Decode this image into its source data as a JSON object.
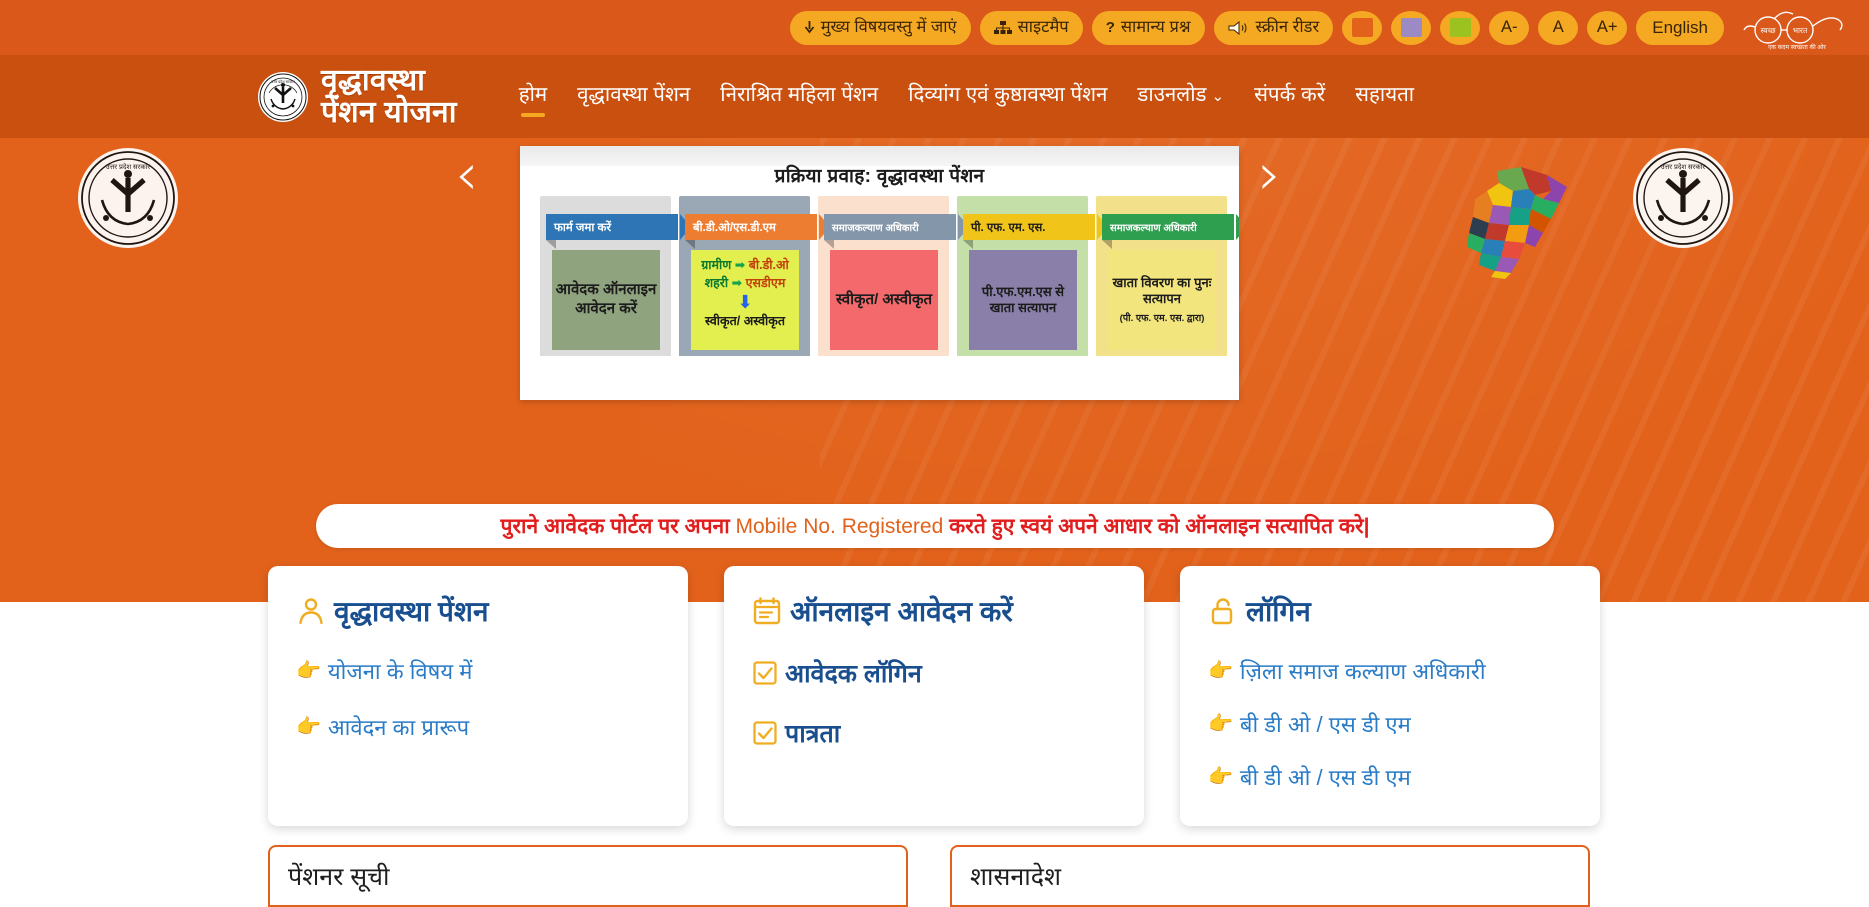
{
  "topbar": {
    "skip_to_main": "मुख्य विषयवस्तु में जाएं",
    "sitemap": "साइटमैप",
    "faq": "सामान्य प्रश्न",
    "screen_reader": "स्क्रीन रीडर",
    "theme_orange": "",
    "theme_purple": "",
    "theme_green": "",
    "font_decrease": "A-",
    "font_normal": "A",
    "font_increase": "A+",
    "language": "English",
    "swachh_bharat_left": "स्वच्छ",
    "swachh_bharat_right": "भारत",
    "swachh_bharat_tagline": "एक कदम स्वच्छता की ओर",
    "colors": {
      "bar": "#d9581a",
      "pill": "#f5a922",
      "orange": "#e2621b",
      "purple": "#9b8ac4",
      "green": "#9cc21f"
    }
  },
  "brand": {
    "line1": "वृद्धावस्था",
    "line2": "पेंशन योजना",
    "emblem_text": "उत्तर प्रदेश सरकार"
  },
  "nav": {
    "items": [
      {
        "label": "होम",
        "active": true,
        "dropdown": false
      },
      {
        "label": "वृद्धावस्था पेंशन",
        "active": false,
        "dropdown": false
      },
      {
        "label": "निराश्रित महिला पेंशन",
        "active": false,
        "dropdown": false
      },
      {
        "label": "दिव्यांग एवं कुष्ठावस्था पेंशन",
        "active": false,
        "dropdown": false
      },
      {
        "label": "डाउनलोड",
        "active": false,
        "dropdown": true
      },
      {
        "label": "संपर्क करें",
        "active": false,
        "dropdown": false
      },
      {
        "label": "सहायता",
        "active": false,
        "dropdown": false
      }
    ],
    "caret": "⌄"
  },
  "carousel": {
    "prev": "‹",
    "next": "›",
    "slide_title": "प्रक्रिया प्रवाह: वृद्धावस्था पेंशन",
    "steps": [
      {
        "header": "फार्म जमा करें",
        "header_bg": "#2e75b6",
        "chevron": "#2e75b6",
        "band_bg": "#dcdcdc",
        "body_bg": "#8fa37e",
        "body": "आवेदक ऑनलाइन आवेदन करें",
        "sub": ""
      },
      {
        "header": "बी.डी.ओ/एस.डी.एम",
        "header_bg": "#ed7d31",
        "chevron": "#ed7d31",
        "band_bg": "#9aa7b5",
        "body_bg": "#e3ef4e",
        "body": "",
        "sub": "",
        "rows": [
          {
            "left": "ग्रामीण",
            "arrow": "➡",
            "right": "बी.डी.ओ"
          },
          {
            "left": "शहरी",
            "arrow": "➡",
            "right": "एसडीएम"
          }
        ],
        "down_arrow": "⬇",
        "result": "स्वीकृत/ अस्वीकृत"
      },
      {
        "header": "समाजकल्याण अधिकारी",
        "header_bg": "#8496a9",
        "chevron": "#8496a9",
        "band_bg": "#fbe0ce",
        "body_bg": "#f4696b",
        "body": "स्वीकृत/ अस्वीकृत",
        "sub": ""
      },
      {
        "header": "पी. एफ. एम. एस.",
        "header_bg": "#f0c419",
        "chevron": "#f0c419",
        "band_bg": "#c5dfa8",
        "body_bg": "#8a7fa8",
        "body": "पी.एफ.एम.एस से खाता सत्यापन",
        "sub": ""
      },
      {
        "header": "समाजकल्याण अधिकारी",
        "header_bg": "#2e9e4f",
        "chevron": "#2e9e4f",
        "band_bg": "#f2e08a",
        "body_bg": "#f3e57e",
        "body": "खाता विवरण का पुनः सत्यापन",
        "sub": "(पी. एफ. एम. एस. द्वारा)"
      }
    ]
  },
  "notice": {
    "part1": "पुराने आवेदक पोर्टल पर अपना ",
    "part2": "Mobile No. Registered ",
    "part3": "करते हुए स्वयं अपने आधार को ऑनलाइन सत्यापित करे|"
  },
  "cards": [
    {
      "icon": "person-icon",
      "title": "वृद्धावस्था पेंशन",
      "links": [
        {
          "icon": "pointing-hand-icon",
          "label": "योजना के विषय में"
        },
        {
          "icon": "pointing-hand-icon",
          "label": "आवेदन का प्रारूप"
        }
      ]
    },
    {
      "icon": "calendar-form-icon",
      "title": "ऑनलाइन आवेदन करें",
      "links": [
        {
          "icon": "checkbox-icon",
          "label": "आवेदक लॉगिन"
        },
        {
          "icon": "checkbox-icon",
          "label": "पात्रता"
        }
      ]
    },
    {
      "icon": "lock-open-icon",
      "title": "लॉगिन",
      "links": [
        {
          "icon": "pointing-hand-icon",
          "label": "ज़िला समाज कल्याण अधिकारी"
        },
        {
          "icon": "pointing-hand-icon",
          "label": "बी डी ओ / एस डी एम"
        },
        {
          "icon": "pointing-hand-icon",
          "label": "बी डी ओ / एस डी एम"
        }
      ]
    }
  ],
  "panels": [
    {
      "title": "पेंशनर सूची"
    },
    {
      "title": "शासनादेश"
    }
  ]
}
